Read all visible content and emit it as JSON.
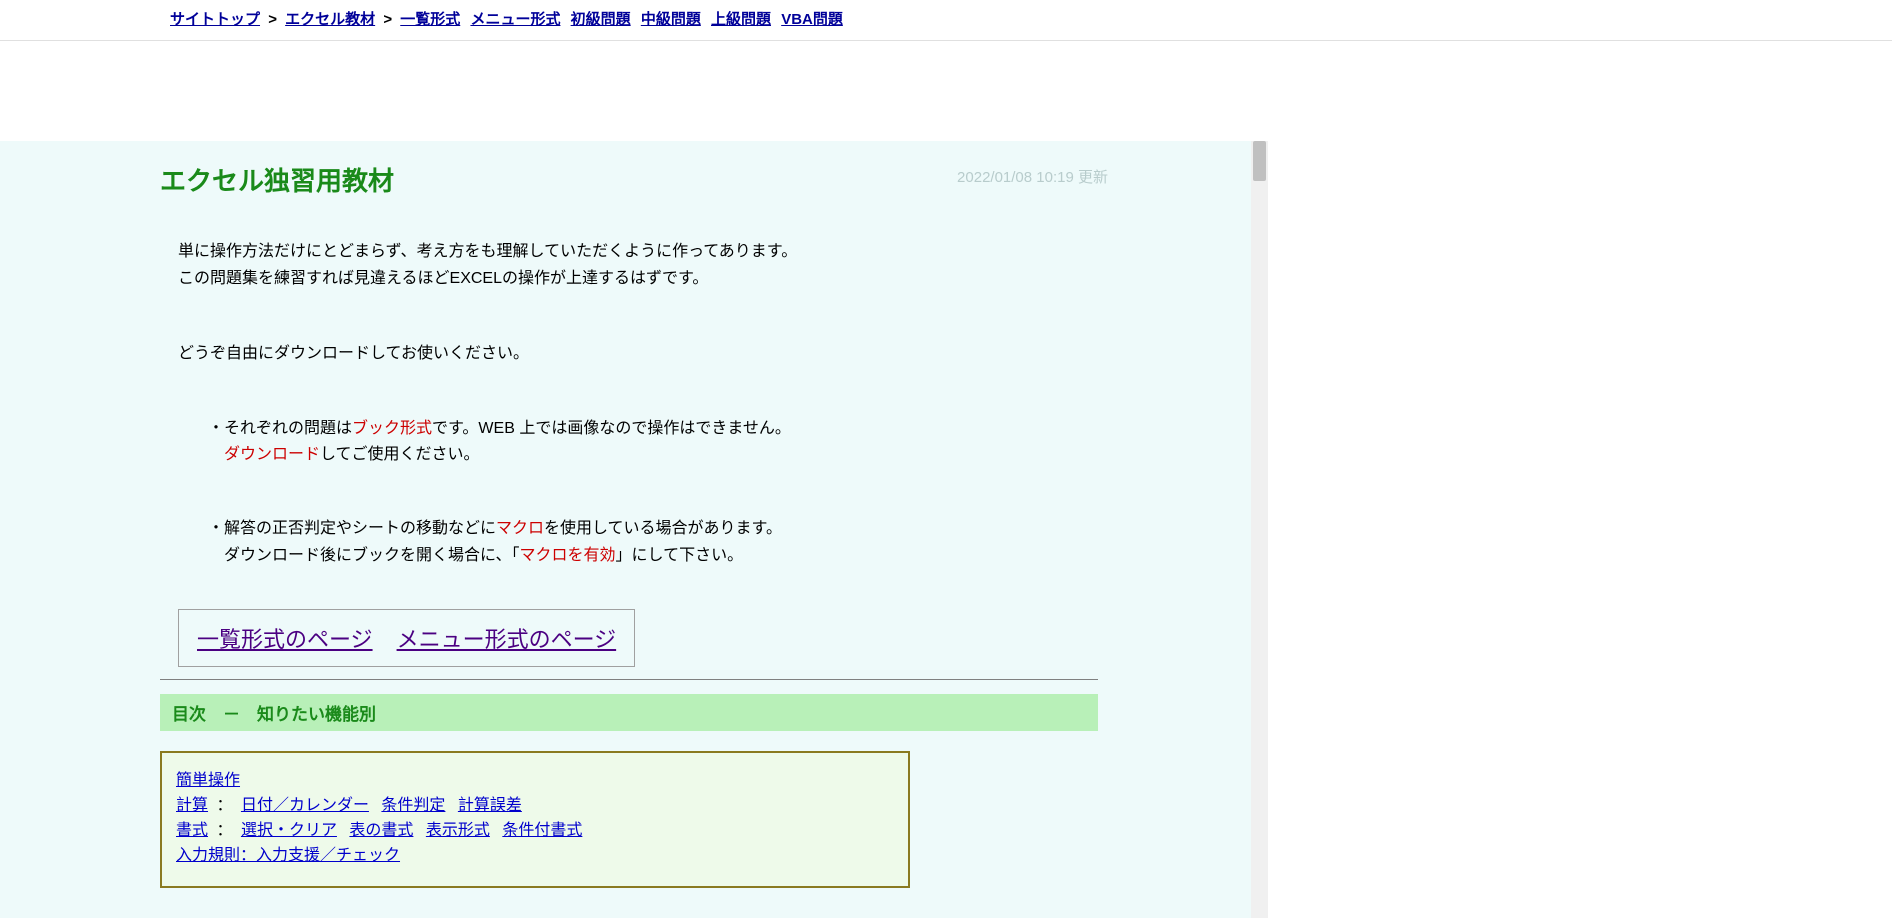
{
  "breadcrumb": {
    "site_top": "サイトトップ",
    "sep": ">",
    "excel_materials": "エクセル教材",
    "list_format": "一覧形式",
    "menu_format": "メニュー形式",
    "beginner": "初級問題",
    "intermediate": "中級問題",
    "advanced": "上級問題",
    "vba": "VBA問題"
  },
  "header": {
    "title": "エクセル独習用教材",
    "timestamp": "2022/01/08 10:19 更新"
  },
  "intro": {
    "line1": "単に操作方法だけにとどまらず、考え方をも理解していただくように作ってあります。",
    "line2": "この問題集を練習すれば見違えるほどEXCELの操作が上達するはずです。",
    "line3": "どうぞ自由にダウンロードしてお使いください。"
  },
  "bullets": {
    "b1_prefix": "・それぞれの問題は",
    "b1_red1": "ブック形式",
    "b1_suffix1": "です。WEB 上では画像なので操作はできません。",
    "b1_red2": "ダウンロード",
    "b1_suffix2": "してご使用ください。",
    "b2_prefix": "・解答の正否判定やシートの移動などに",
    "b2_red1": "マクロ",
    "b2_suffix1": "を使用している場合があります。",
    "b2_line2a": "ダウンロード後にブックを開く場合に、「",
    "b2_red2": "マクロを有効",
    "b2_line2b": "」にして下さい。"
  },
  "page_links": {
    "list_page": "一覧形式のページ",
    "menu_page": "メニュー形式のページ"
  },
  "toc": {
    "header": "目次　－　知りたい機能別",
    "simple_op": "簡単操作",
    "calc": "計算",
    "colon": "：",
    "date_calendar": "日付／カレンダー",
    "condition": "条件判定",
    "calc_error": "計算誤差",
    "format": "書式",
    "select_clear": "選択・クリア",
    "table_format": "表の書式",
    "display_format": "表示形式",
    "conditional_format": "条件付書式",
    "input_rule": "入力規則：入力支援／チェック"
  }
}
